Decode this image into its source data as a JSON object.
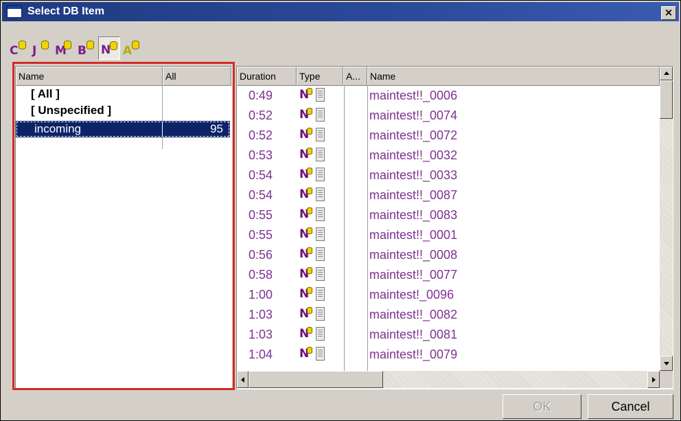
{
  "window": {
    "title": "Select DB Item",
    "close_glyph": "×"
  },
  "toolbar": [
    {
      "letter": "C",
      "color": "#7b1d8c",
      "icon": "db-type-c-icon",
      "active": false
    },
    {
      "letter": "J",
      "color": "#7b1d8c",
      "icon": "db-type-j-icon",
      "active": false
    },
    {
      "letter": "M",
      "color": "#7b1d8c",
      "icon": "db-type-m-icon",
      "active": false
    },
    {
      "letter": "B",
      "color": "#7b1d8c",
      "icon": "db-type-b-icon",
      "active": false
    },
    {
      "letter": "N",
      "color": "#7b1d8c",
      "icon": "db-type-n-icon",
      "active": true
    },
    {
      "letter": "A",
      "color": "#b4ad10",
      "icon": "db-type-a-icon",
      "active": false
    }
  ],
  "left_list": {
    "headers": {
      "name": "Name",
      "count": "All"
    },
    "rows": [
      {
        "name": "[ All ]",
        "count": "",
        "bold": true,
        "selected": false
      },
      {
        "name": "[ Unspecified ]",
        "count": "",
        "bold": true,
        "selected": false
      },
      {
        "name": "incoming",
        "count": "95",
        "bold": false,
        "selected": true
      }
    ]
  },
  "right_list": {
    "headers": {
      "duration": "Duration",
      "type": "Type",
      "a": "A...",
      "name": "Name"
    },
    "type_letter": "N",
    "rows": [
      {
        "duration": "0:49",
        "name": "maintest!!_0006"
      },
      {
        "duration": "0:52",
        "name": "maintest!!_0074"
      },
      {
        "duration": "0:52",
        "name": "maintest!!_0072"
      },
      {
        "duration": "0:53",
        "name": "maintest!!_0032"
      },
      {
        "duration": "0:54",
        "name": "maintest!!_0033"
      },
      {
        "duration": "0:54",
        "name": "maintest!!_0087"
      },
      {
        "duration": "0:55",
        "name": "maintest!!_0083"
      },
      {
        "duration": "0:55",
        "name": "maintest!!_0001"
      },
      {
        "duration": "0:56",
        "name": "maintest!!_0008"
      },
      {
        "duration": "0:58",
        "name": "maintest!!_0077"
      },
      {
        "duration": "1:00",
        "name": "maintest!_0096"
      },
      {
        "duration": "1:03",
        "name": "maintest!!_0082"
      },
      {
        "duration": "1:03",
        "name": "maintest!!_0081"
      },
      {
        "duration": "1:04",
        "name": "maintest!!_0079"
      }
    ]
  },
  "buttons": {
    "ok": "OK",
    "cancel": "Cancel"
  },
  "colors": {
    "selection": "#0d2368",
    "item_text": "#7f3190",
    "highlight_border": "#d42a26"
  }
}
